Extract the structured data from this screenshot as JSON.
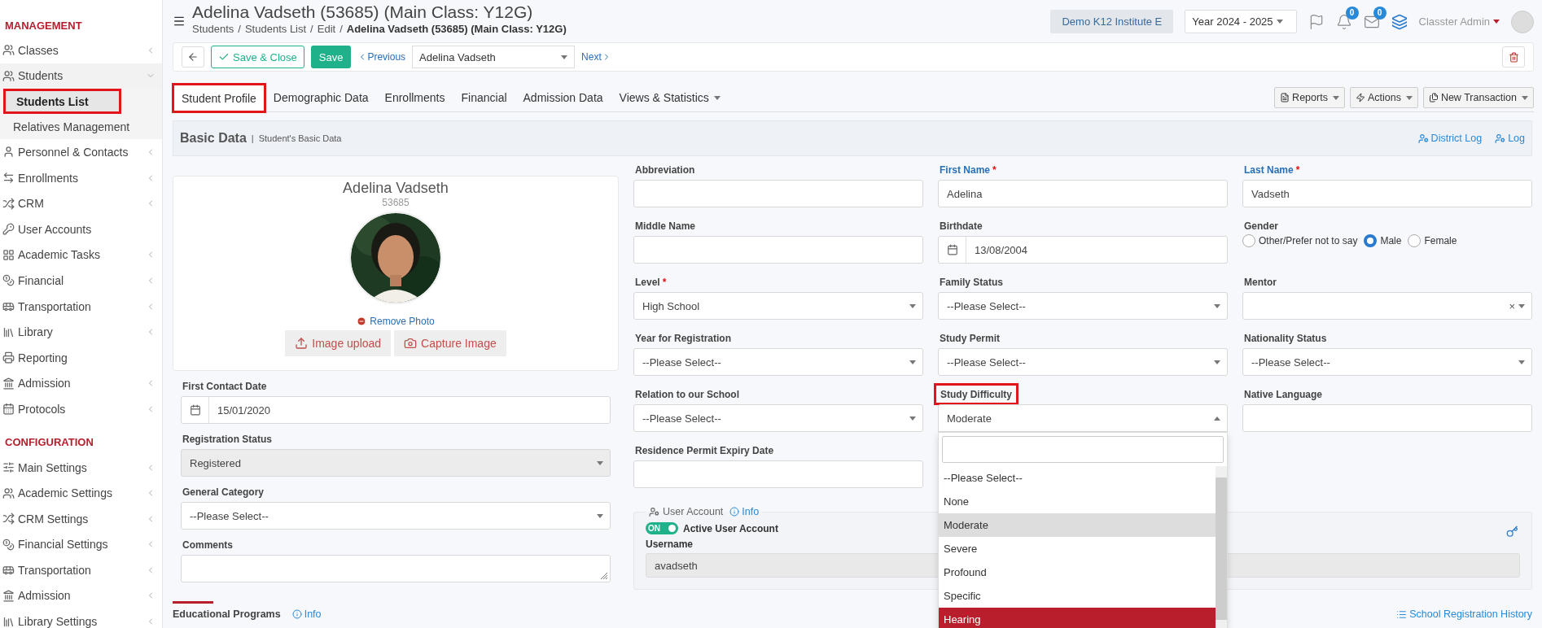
{
  "sidebar": [
    {
      "title": "MANAGEMENT",
      "items": [
        {
          "label": "Classes",
          "expanded": false
        },
        {
          "label": "Students",
          "expanded": true,
          "children": [
            {
              "label": "Students List",
              "selected": true,
              "highlighted": true
            },
            {
              "label": "Relatives Management",
              "selected": false,
              "highlighted": false
            }
          ]
        },
        {
          "label": "Personnel & Contacts",
          "expanded": false
        },
        {
          "label": "Enrollments",
          "expanded": false
        },
        {
          "label": "CRM",
          "expanded": false
        },
        {
          "label": "User Accounts"
        },
        {
          "label": "Academic Tasks",
          "expanded": false
        },
        {
          "label": "Financial",
          "expanded": false
        },
        {
          "label": "Transportation",
          "expanded": false
        },
        {
          "label": "Library",
          "expanded": false
        },
        {
          "label": "Reporting"
        },
        {
          "label": "Admission",
          "expanded": false
        },
        {
          "label": "Protocols",
          "expanded": false
        }
      ]
    },
    {
      "title": "CONFIGURATION",
      "items": [
        {
          "label": "Main Settings",
          "expanded": false
        },
        {
          "label": "Academic Settings",
          "expanded": false
        },
        {
          "label": "CRM Settings",
          "expanded": false
        },
        {
          "label": "Financial Settings",
          "expanded": false
        },
        {
          "label": "Transportation",
          "expanded": false
        },
        {
          "label": "Admission",
          "expanded": false
        },
        {
          "label": "Library Settings",
          "expanded": false
        }
      ]
    }
  ],
  "header": {
    "title": "Adelina Vadseth (53685) (Main Class: Y12G)",
    "breadcrumb": [
      "Students",
      "Students List",
      "Edit"
    ],
    "separator": "/",
    "breadcrumb_current": "Adelina Vadseth (53685) (Main Class: Y12G)",
    "institute": "Demo K12 Institute E",
    "year": "Year 2024 - 2025",
    "notifications": "0",
    "messages": "0",
    "user": "Classter Admin"
  },
  "toolbar": {
    "save_close": "Save & Close",
    "save": "Save",
    "previous": "Previous",
    "record": "Adelina Vadseth",
    "next": "Next"
  },
  "tabs": [
    {
      "label": "Student Profile",
      "selected": true,
      "highlighted": true,
      "menu": false
    },
    {
      "label": "Demographic Data",
      "selected": false,
      "highlighted": false,
      "menu": false
    },
    {
      "label": "Enrollments",
      "selected": false,
      "highlighted": false,
      "menu": false
    },
    {
      "label": "Financial",
      "selected": false,
      "highlighted": false,
      "menu": false
    },
    {
      "label": "Admission Data",
      "selected": false,
      "highlighted": false,
      "menu": false
    },
    {
      "label": "Views & Statistics",
      "selected": false,
      "highlighted": false,
      "menu": true
    }
  ],
  "tab_actions": [
    "Reports",
    "Actions",
    "New Transaction"
  ],
  "section": {
    "title": "Basic Data",
    "divider": "|",
    "subtitle": "Student's Basic Data",
    "links": [
      "District Log",
      "Log"
    ]
  },
  "profile": {
    "name": "Adelina Vadseth",
    "id": "53685",
    "photo": {
      "kind": "picture"
    },
    "remove": "Remove Photo",
    "buttons": [
      "Image upload",
      "Capture Image"
    ]
  },
  "left_fields": [
    {
      "kind": "date",
      "label": "First Contact Date",
      "value": "15/01/2020"
    },
    {
      "kind": "select",
      "label": "Registration Status",
      "value": "Registered",
      "disabled": true
    },
    {
      "kind": "select",
      "label": "General Category",
      "value": "--Please Select--",
      "disabled": false
    },
    {
      "kind": "textarea",
      "label": "Comments"
    }
  ],
  "fields": [
    {
      "kind": "text",
      "label": "Abbreviation",
      "accent": false
    },
    {
      "kind": "text",
      "label": "First Name",
      "required_mark": "*",
      "value": "Adelina",
      "accent": true
    },
    {
      "kind": "text",
      "label": "Last Name",
      "required_mark": "*",
      "value": "Vadseth",
      "accent": true
    },
    {
      "kind": "text",
      "label": "Middle Name",
      "accent": false
    },
    {
      "kind": "date",
      "label": "Birthdate",
      "value": "13/08/2004",
      "accent": false
    },
    {
      "kind": "radio",
      "label": "Gender",
      "accent": false,
      "options": [
        {
          "label": "Other/Prefer not to say",
          "selected": false
        },
        {
          "label": "Male",
          "selected": true
        },
        {
          "label": "Female",
          "selected": false
        }
      ]
    },
    {
      "kind": "select",
      "label": "Level",
      "required_mark": "*",
      "value": "High School",
      "accent": false,
      "open": false
    },
    {
      "kind": "select",
      "label": "Family Status",
      "value": "--Please Select--",
      "accent": false,
      "open": false
    },
    {
      "kind": "select",
      "label": "Mentor",
      "clear": "×",
      "accent": false,
      "open": false
    },
    {
      "kind": "select",
      "label": "Year for Registration",
      "value": "--Please Select--",
      "accent": false,
      "open": false
    },
    {
      "kind": "select",
      "label": "Study Permit",
      "value": "--Please Select--",
      "accent": false,
      "open": false
    },
    {
      "kind": "select",
      "label": "Nationality Status",
      "value": "--Please Select--",
      "accent": false,
      "open": false
    },
    {
      "kind": "select",
      "label": "Relation to our School",
      "value": "--Please Select--",
      "accent": false,
      "open": false
    },
    {
      "kind": "select",
      "label": "Study Difficulty",
      "value": "Moderate",
      "accent": false,
      "highlighted": true,
      "open": true,
      "options": [
        {
          "label": "--Please Select--",
          "selected": false,
          "hovered": false
        },
        {
          "label": "None",
          "selected": false,
          "hovered": false
        },
        {
          "label": "Moderate",
          "selected": true,
          "hovered": false
        },
        {
          "label": "Severe",
          "selected": false,
          "hovered": false
        },
        {
          "label": "Profound",
          "selected": false,
          "hovered": false
        },
        {
          "label": "Specific",
          "selected": false,
          "hovered": false
        },
        {
          "label": "Hearing",
          "selected": false,
          "hovered": true
        }
      ]
    },
    {
      "kind": "text",
      "label": "Native Language",
      "accent": false
    },
    {
      "kind": "text",
      "label": "Residence Permit Expiry Date",
      "accent": false
    }
  ],
  "user_account": {
    "title": "User Account",
    "info": "Info",
    "toggle": {
      "on": true,
      "label": "ON"
    },
    "toggle_label": "Active User Account",
    "username_label": "Username",
    "username": "avadseth"
  },
  "educational_programs": {
    "title": "Educational Programs",
    "info": "Info"
  },
  "registration_history": "School Registration History"
}
